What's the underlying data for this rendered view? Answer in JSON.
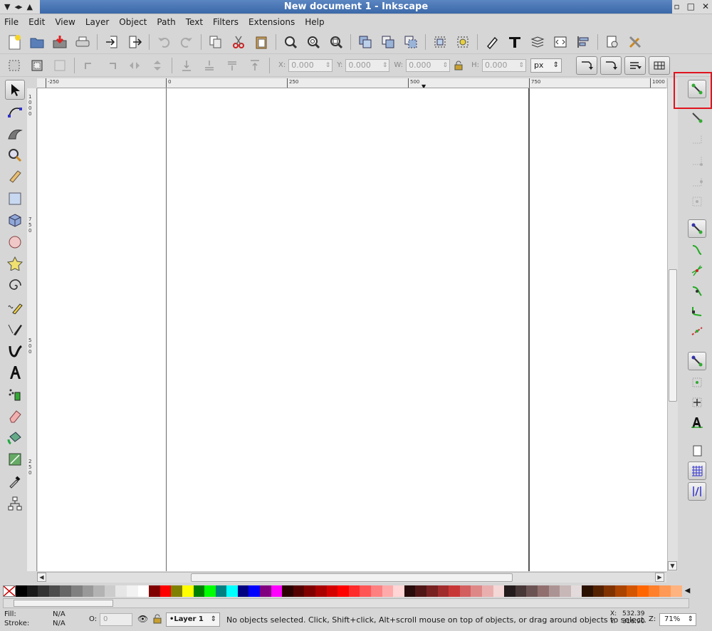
{
  "window": {
    "title": "New document 1 - Inkscape"
  },
  "menu": [
    {
      "label": "File",
      "key": "F",
      "rest": "ile"
    },
    {
      "label": "Edit",
      "key": "E",
      "rest": "dit"
    },
    {
      "label": "View",
      "key": "V",
      "rest": "iew"
    },
    {
      "label": "Layer",
      "key": "L",
      "rest": "ayer"
    },
    {
      "label": "Object",
      "key": "O",
      "rest": "bject"
    },
    {
      "label": "Path",
      "key": "P",
      "rest": "ath"
    },
    {
      "label": "Text",
      "key": "T",
      "rest": "ext"
    },
    {
      "label": "Filters",
      "key": "r",
      "pre": "Filte",
      "rest": "s"
    },
    {
      "label": "Extensions",
      "key": "n",
      "pre": "Exte",
      "rest": "sions"
    },
    {
      "label": "Help",
      "key": "H",
      "rest": "elp"
    }
  ],
  "selector_toolbar": {
    "x_label": "X:",
    "x_value": "0.000",
    "y_label": "Y:",
    "y_value": "0.000",
    "w_label": "W:",
    "w_value": "0.000",
    "h_label": "H:",
    "h_value": "0.000",
    "unit": "px"
  },
  "rulers": {
    "top": [
      "-250",
      "0",
      "250",
      "500",
      "750",
      "1000"
    ],
    "left": [
      "1000",
      "750",
      "500",
      "250"
    ]
  },
  "status": {
    "fill_label": "Fill:",
    "fill_value": "N/A",
    "stroke_label": "Stroke:",
    "stroke_value": "N/A",
    "opacity_label": "O:",
    "opacity_value": "0",
    "layer": "•Layer 1",
    "message": "No objects selected. Click, Shift+click, Alt+scroll mouse on top of objects, or drag around objects to select.",
    "cursor_x_label": "X:",
    "cursor_x": "532.39",
    "cursor_y_label": "Y:",
    "cursor_y": "316.90",
    "zoom_label": "Z:",
    "zoom": "71%"
  },
  "palette": [
    "#000000",
    "#1a1a1a",
    "#333333",
    "#4d4d4d",
    "#666666",
    "#808080",
    "#999999",
    "#b3b3b3",
    "#cccccc",
    "#e6e6e6",
    "#f2f2f2",
    "#ffffff",
    "#800000",
    "#ff0000",
    "#808000",
    "#ffff00",
    "#008000",
    "#00ff00",
    "#008080",
    "#00ffff",
    "#000080",
    "#0000ff",
    "#800080",
    "#ff00ff",
    "#2b0000",
    "#550000",
    "#800000",
    "#aa0000",
    "#d40000",
    "#ff0000",
    "#ff2a2a",
    "#ff5555",
    "#ff8080",
    "#ffaaaa",
    "#ffd5d5",
    "#280b0b",
    "#501616",
    "#782121",
    "#a02c2c",
    "#c83737",
    "#d35f5f",
    "#de8787",
    "#e9afaf",
    "#f4d7d7",
    "#241c1c",
    "#483737",
    "#6c5353",
    "#916f6f",
    "#ac9393",
    "#c8b7b7",
    "#e3dbdb",
    "#2b1100",
    "#552200",
    "#803300",
    "#aa4400",
    "#d45500",
    "#ff6600",
    "#ff7f2a",
    "#ff9955",
    "#ffb380"
  ]
}
